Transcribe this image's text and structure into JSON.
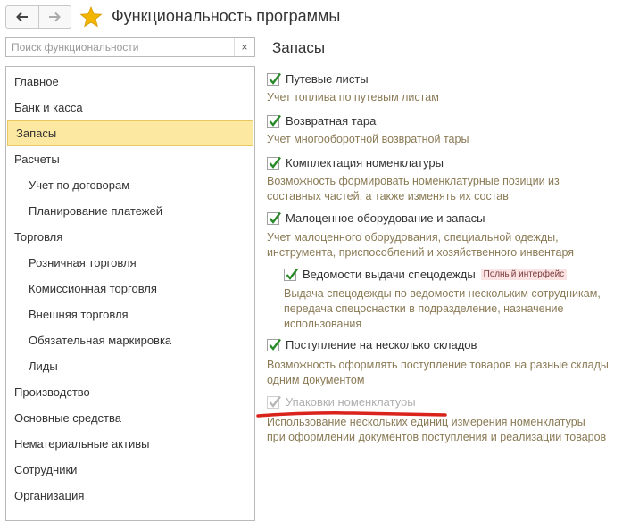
{
  "header": {
    "title": "Функциональность программы",
    "back_icon": "arrow-left-icon",
    "forward_icon": "arrow-right-icon",
    "favorite_icon": "star-icon",
    "favorite_color": "#f2b600"
  },
  "search": {
    "placeholder": "Поиск функциональности",
    "value": "",
    "clear_label": "×"
  },
  "sidebar": {
    "items": [
      {
        "label": "Главное"
      },
      {
        "label": "Банк и касса"
      },
      {
        "label": "Запасы"
      },
      {
        "label": "Расчеты"
      },
      {
        "label": "Учет по договорам"
      },
      {
        "label": "Планирование платежей"
      },
      {
        "label": "Торговля"
      },
      {
        "label": "Розничная торговля"
      },
      {
        "label": "Комиссионная торговля"
      },
      {
        "label": "Внешняя торговля"
      },
      {
        "label": "Обязательная маркировка"
      },
      {
        "label": "Лиды"
      },
      {
        "label": "Производство"
      },
      {
        "label": "Основные средства"
      },
      {
        "label": "Нематериальные активы"
      },
      {
        "label": "Сотрудники"
      },
      {
        "label": "Организация"
      }
    ],
    "active": "Запасы",
    "active_color": "#fce8a0"
  },
  "main": {
    "section_title": "Запасы",
    "options": [
      {
        "label": "Путевые листы",
        "checked": true,
        "desc": [
          "Учет топлива по путевым листам"
        ]
      },
      {
        "label": "Возвратная тара",
        "checked": true,
        "desc": [
          "Учет многооборотной возвратной тары"
        ]
      },
      {
        "label": "Комплектация номенклатуры",
        "checked": true,
        "desc": [
          "Возможность формировать номенклатурные позиции из",
          "составных частей, а также изменять их состав"
        ]
      },
      {
        "label": "Малоценное оборудование и запасы",
        "checked": true,
        "desc": [
          "Учет малоценного оборудования, специальной одежды,",
          "инструмента, приспособлений и хозяйственного инвентаря"
        ]
      },
      {
        "label": "Ведомости выдачи спецодежды",
        "checked": true,
        "badge": "Полный интерфейс",
        "desc": [
          "Выдача спецодежды по ведомости нескольким сотрудникам,",
          "передача спецоснастки в подразделение, назначение",
          "использования"
        ]
      },
      {
        "label": "Поступление на несколько складов",
        "checked": true,
        "desc": [
          "Возможность оформлять поступление товаров на разные склады",
          "одним документом"
        ]
      },
      {
        "label": "Упаковки номенклатуры",
        "checked": true,
        "disabled": true,
        "desc": [
          "Использование нескольких единиц измерения номенклатуры",
          "при оформлении документов поступления и реализации товаров"
        ]
      }
    ],
    "check_color": "#2a8a2a",
    "description_color": "#8a7a55",
    "highlight_mark_color": "#d9231b"
  }
}
